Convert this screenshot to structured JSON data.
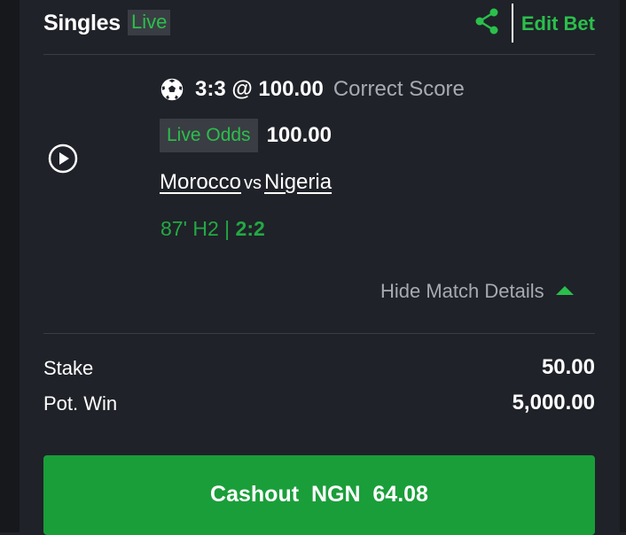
{
  "header": {
    "title": "Singles",
    "live_badge": "Live",
    "edit_bet": "Edit Bet",
    "share_icon": "share-icon"
  },
  "selection": {
    "pick": "3:3 @ 100.00",
    "market": "Correct Score",
    "live_odds_label": "Live Odds",
    "live_odds_value": "100.00",
    "home_team": "Morocco",
    "vs": "vs",
    "away_team": "Nigeria",
    "match_time": "87' H2 | ",
    "current_score": "2:2",
    "hide_details": "Hide Match Details"
  },
  "summary": {
    "stake_label": "Stake",
    "stake_value": "50.00",
    "potwin_label": "Pot. Win",
    "potwin_value": "5,000.00"
  },
  "cashout": {
    "label": "Cashout  NGN  64.08"
  },
  "colors": {
    "background": "#1f2228",
    "accent_green": "#2bbf4c",
    "button_green": "#1a9e3a",
    "muted_text": "#a7aab0",
    "badge_bg": "#3a3d43"
  }
}
